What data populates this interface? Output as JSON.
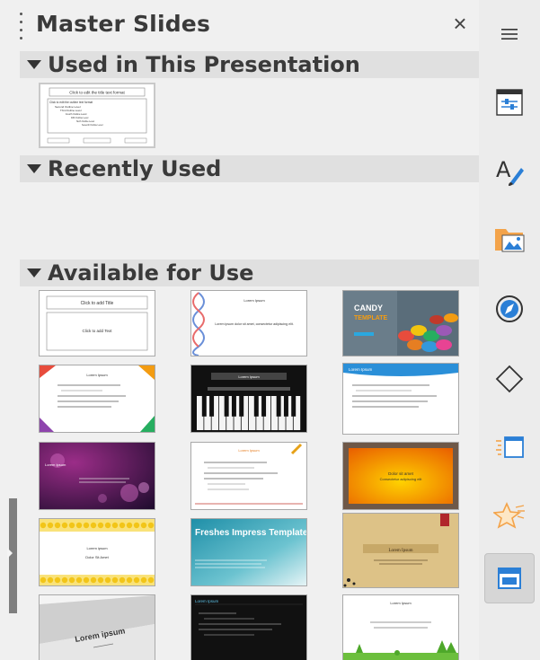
{
  "panel": {
    "title": "Master Slides",
    "close_glyph": "×"
  },
  "sections": {
    "used": {
      "label": "Used in This Presentation"
    },
    "recent": {
      "label": "Recently Used"
    },
    "available": {
      "label": "Available for Use"
    }
  },
  "used_templates": [
    {
      "title": "Click to edit the title text format",
      "outline": [
        "Click to edit the outline text format",
        "Second Outline Level",
        "Third Outline Level",
        "Fourth Outline Level",
        "Fifth Outline Level",
        "Sixth Outline Level",
        "Seventh Outline Level"
      ]
    }
  ],
  "available_templates": [
    {
      "name": "default",
      "title": "Click to add Title",
      "body": "Click to add Text"
    },
    {
      "name": "dna",
      "title": "Lorem Ipsum",
      "body": "Lorem ipsum dolor sit amet, consectetur adipiscing elit."
    },
    {
      "name": "candy",
      "title": "CANDY",
      "subtitle": "TEMPLATE"
    },
    {
      "name": "focus",
      "title": "Lorem Ipsum"
    },
    {
      "name": "piano",
      "title": "Lorem Ipsum"
    },
    {
      "name": "blue-curve",
      "title": "Lorem Ipsum"
    },
    {
      "name": "night",
      "title": "Lorem Ipsum"
    },
    {
      "name": "pencil",
      "title": "Lorem Ipsum"
    },
    {
      "name": "sunset",
      "title": "Dolor sit amet",
      "body": "Consectetur adipiscing elit"
    },
    {
      "name": "honeycomb",
      "title": "Lorem ipsum",
      "body": "Dolor Sit Amet"
    },
    {
      "name": "freshes",
      "title": "Freshes Impress Template"
    },
    {
      "name": "parchment",
      "title": "Lorem Ipsum"
    },
    {
      "name": "beehive",
      "title": "Lorem ipsum"
    },
    {
      "name": "dark",
      "title": "Lorem Ipsum"
    },
    {
      "name": "nature",
      "title": "Lorem Ipsum"
    }
  ],
  "sidebar": {
    "items": [
      {
        "name": "menu-icon"
      },
      {
        "name": "properties-icon"
      },
      {
        "name": "styles-icon"
      },
      {
        "name": "gallery-icon"
      },
      {
        "name": "navigator-icon"
      },
      {
        "name": "shapes-icon"
      },
      {
        "name": "slide-transition-icon"
      },
      {
        "name": "animation-icon"
      },
      {
        "name": "master-slides-icon",
        "active": true
      }
    ]
  },
  "colors": {
    "panel_bg": "#f0f0f0",
    "header_bg": "#e0e0e0",
    "accent_orange": "#f39c12"
  }
}
